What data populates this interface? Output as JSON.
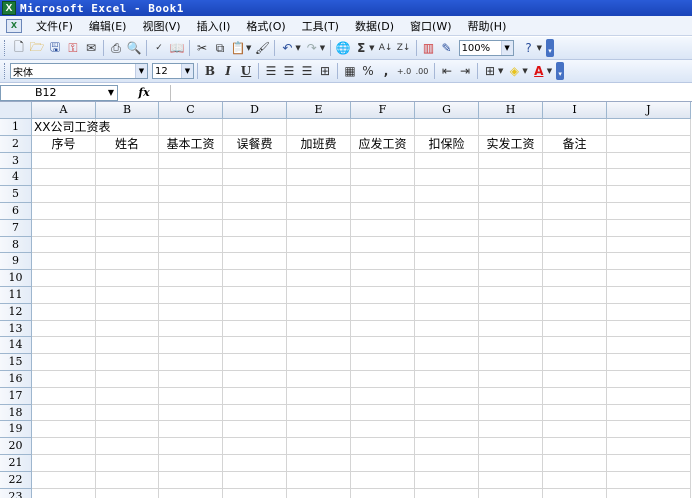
{
  "window": {
    "title": "Microsoft Excel - Book1"
  },
  "menu": [
    "文件(F)",
    "编辑(E)",
    "视图(V)",
    "插入(I)",
    "格式(O)",
    "工具(T)",
    "数据(D)",
    "窗口(W)",
    "帮助(H)"
  ],
  "toolbar": {
    "zoom": "100%",
    "sigma": "Σ"
  },
  "format_toolbar": {
    "font_name": "宋体",
    "font_size": "12",
    "bold": "B",
    "italic": "I",
    "underline": "U",
    "percent": "%",
    "comma": ","
  },
  "formula_bar": {
    "name_box": "B12",
    "fx": "fx",
    "formula": ""
  },
  "columns": [
    "A",
    "B",
    "C",
    "D",
    "E",
    "F",
    "G",
    "H",
    "I",
    "J"
  ],
  "rows": [
    "1",
    "2",
    "3",
    "4",
    "5",
    "6",
    "7",
    "8",
    "9",
    "10",
    "11",
    "12",
    "13",
    "14",
    "15",
    "16",
    "17",
    "18",
    "19",
    "20",
    "21",
    "22",
    "23"
  ],
  "cells": {
    "A1": "XX公司工资表",
    "A2": "序号",
    "B2": "姓名",
    "C2": "基本工资",
    "D2": "误餐费",
    "E2": "加班费",
    "F2": "应发工资",
    "G2": "扣保险",
    "H2": "实发工资",
    "I2": "备注"
  }
}
